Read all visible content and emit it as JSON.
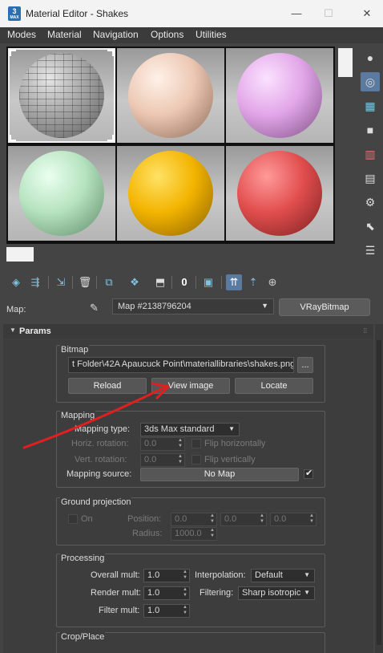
{
  "window": {
    "title": "Material Editor - Shakes",
    "app_icon_main": "3",
    "app_icon_sub": "MAX",
    "minimize": "—",
    "maximize": "☐",
    "close": "✕"
  },
  "menu": [
    "Modes",
    "Material",
    "Navigation",
    "Options",
    "Utilities"
  ],
  "preview": {
    "slots": [
      {
        "color": "#a5a5a5",
        "texture": "stone-bricks",
        "active": true
      },
      {
        "color": "#ecc8b3"
      },
      {
        "color": "#e2a6e8"
      },
      {
        "color": "#b6e3bf"
      },
      {
        "color": "#f3b400"
      },
      {
        "color": "#e24e4e"
      }
    ]
  },
  "side_tools": [
    "sample-type-icon",
    "backlight-icon",
    "background-icon",
    "sample-uv-tiling-icon",
    "video-color-check-icon",
    "make-preview-icon",
    "options-icon",
    "select-by-material-icon",
    "material-map-navigator-icon"
  ],
  "toolbar_icons": [
    "get-material-icon",
    "put-to-scene-icon",
    "assign-to-selection-icon",
    "reset-map-icon",
    "copy-material-icon",
    "make-unique-icon",
    "put-to-library-icon",
    "material-id-channel-icon",
    "show-shaded-material-icon",
    "show-end-result-icon",
    "go-to-parent-icon",
    "go-forward-to-sibling-icon"
  ],
  "map": {
    "label": "Map:",
    "name": "Map #2138796204",
    "type_button": "VRayBitmap"
  },
  "params": {
    "title": "Params",
    "bitmap": {
      "label": "Bitmap",
      "path": "t Folder\\42A Apaucuck Point\\materiallibraries\\shakes.png",
      "browse": "...",
      "reload": "Reload",
      "view_image": "View image",
      "locate": "Locate"
    },
    "mapping": {
      "label": "Mapping",
      "type_label": "Mapping type:",
      "type_value": "3ds Max standard",
      "horiz_label": "Horiz. rotation:",
      "horiz_value": "0.0",
      "flip_h": "Flip horizontally",
      "vert_label": "Vert. rotation:",
      "vert_value": "0.0",
      "flip_v": "Flip vertically",
      "source_label": "Mapping source:",
      "source_value": "No Map",
      "source_checked": true
    },
    "ground": {
      "label": "Ground projection",
      "on": "On",
      "position_label": "Position:",
      "pos_x": "0.0",
      "pos_y": "0.0",
      "pos_z": "0.0",
      "radius_label": "Radius:",
      "radius": "1000.0"
    },
    "processing": {
      "label": "Processing",
      "overall_label": "Overall mult:",
      "overall": "1.0",
      "interp_label": "Interpolation:",
      "interp": "Default",
      "render_label": "Render mult:",
      "render": "1.0",
      "filtering_label": "Filtering:",
      "filtering": "Sharp isotropic",
      "filter_label": "Filter mult:",
      "filter": "1.0"
    },
    "crop": {
      "label": "Crop/Place"
    }
  },
  "annotation": {
    "color": "#e02020"
  }
}
